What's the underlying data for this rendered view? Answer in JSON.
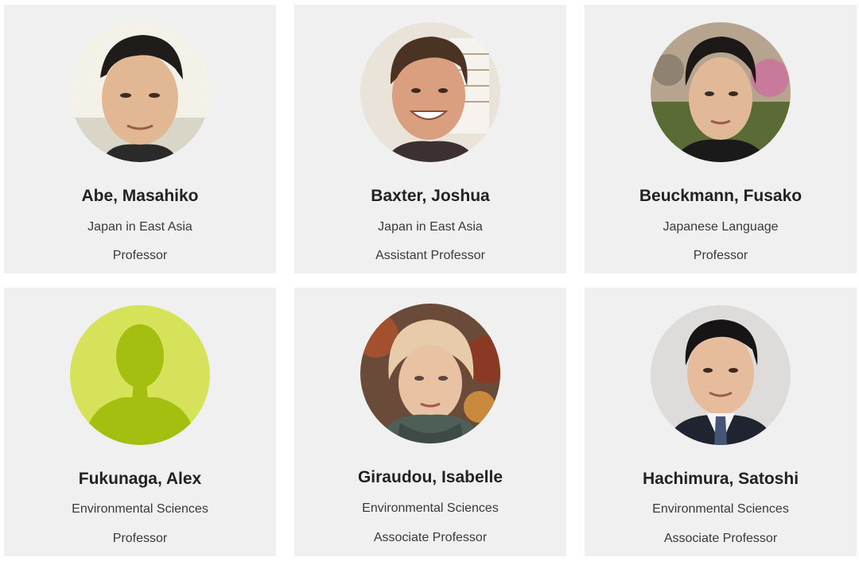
{
  "people": [
    {
      "name": "Abe, Masahiko",
      "department": "Japan in East Asia",
      "title": "Professor",
      "photo": "portrait-photo"
    },
    {
      "name": "Baxter, Joshua",
      "department": "Japan in East Asia",
      "title": "Assistant Professor",
      "photo": "portrait-photo"
    },
    {
      "name": "Beuckmann, Fusako",
      "department": "Japanese Language",
      "title": "Professor",
      "photo": "portrait-photo"
    },
    {
      "name": "Fukunaga, Alex",
      "department": "Environmental Sciences",
      "title": "Professor",
      "photo": "default-user-silhouette-icon"
    },
    {
      "name": "Giraudou, Isabelle",
      "department": "Environmental Sciences",
      "title": "Associate Professor",
      "photo": "portrait-photo"
    },
    {
      "name": "Hachimura, Satoshi",
      "department": "Environmental Sciences",
      "title": "Associate Professor",
      "photo": "portrait-photo"
    }
  ],
  "colors": {
    "card_background": "#f0f0f0",
    "placeholder_avatar_bg": "#d6e25a",
    "placeholder_avatar_figure": "#a5bf10"
  }
}
